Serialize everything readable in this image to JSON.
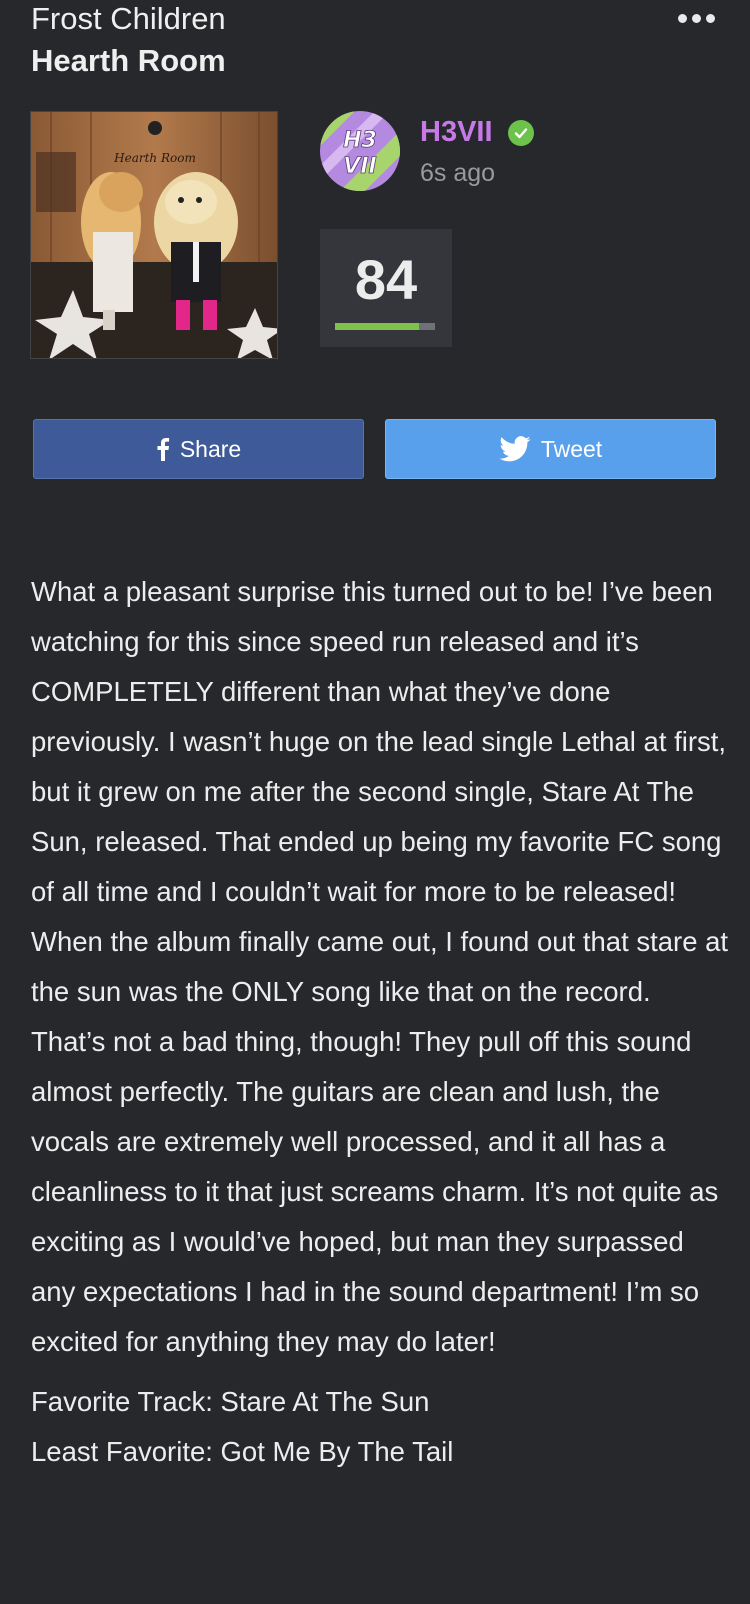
{
  "header": {
    "artist": "Frost Children",
    "album": "Hearth Room",
    "more_icon": "more-horizontal-icon"
  },
  "cover": {
    "sign_text": "Hearth Room"
  },
  "user": {
    "avatar_text": "H3VII",
    "name": "H3VII",
    "verified_icon": "check-badge-icon",
    "time_ago": "6s ago",
    "accent_color": "#c879e8"
  },
  "rating": {
    "score": "84",
    "score_value": 84,
    "bar_color": "#7fc14a"
  },
  "actions": {
    "share_label": "Share",
    "tweet_label": "Tweet",
    "share_color": "#3f5a98",
    "tweet_color": "#58a0eb"
  },
  "review": {
    "body": "What a pleasant surprise this turned out to be! I’ve been watching for this since speed run released and it’s COMPLETELY different than what they’ve done previously. I wasn’t huge on the lead single Lethal at first, but it grew on me after the second single, Stare At The Sun, released. That ended up being my favorite FC song of all time and I couldn’t wait for more to be released! When the album finally came out, I found out that stare at the sun was the ONLY song like that on the record. That’s not a bad thing, though! They pull off this sound almost perfectly. The guitars are clean and lush, the vocals are extremely well processed, and it all has a cleanliness to it that just screams charm. It’s not quite as exciting as I would’ve hoped, but man they surpassed any expectations I had in the sound department! I’m so excited for anything they may do later!",
    "favorite_track": "Favorite Track: Stare At The Sun",
    "least_favorite": "Least Favorite: Got Me By The Tail"
  }
}
